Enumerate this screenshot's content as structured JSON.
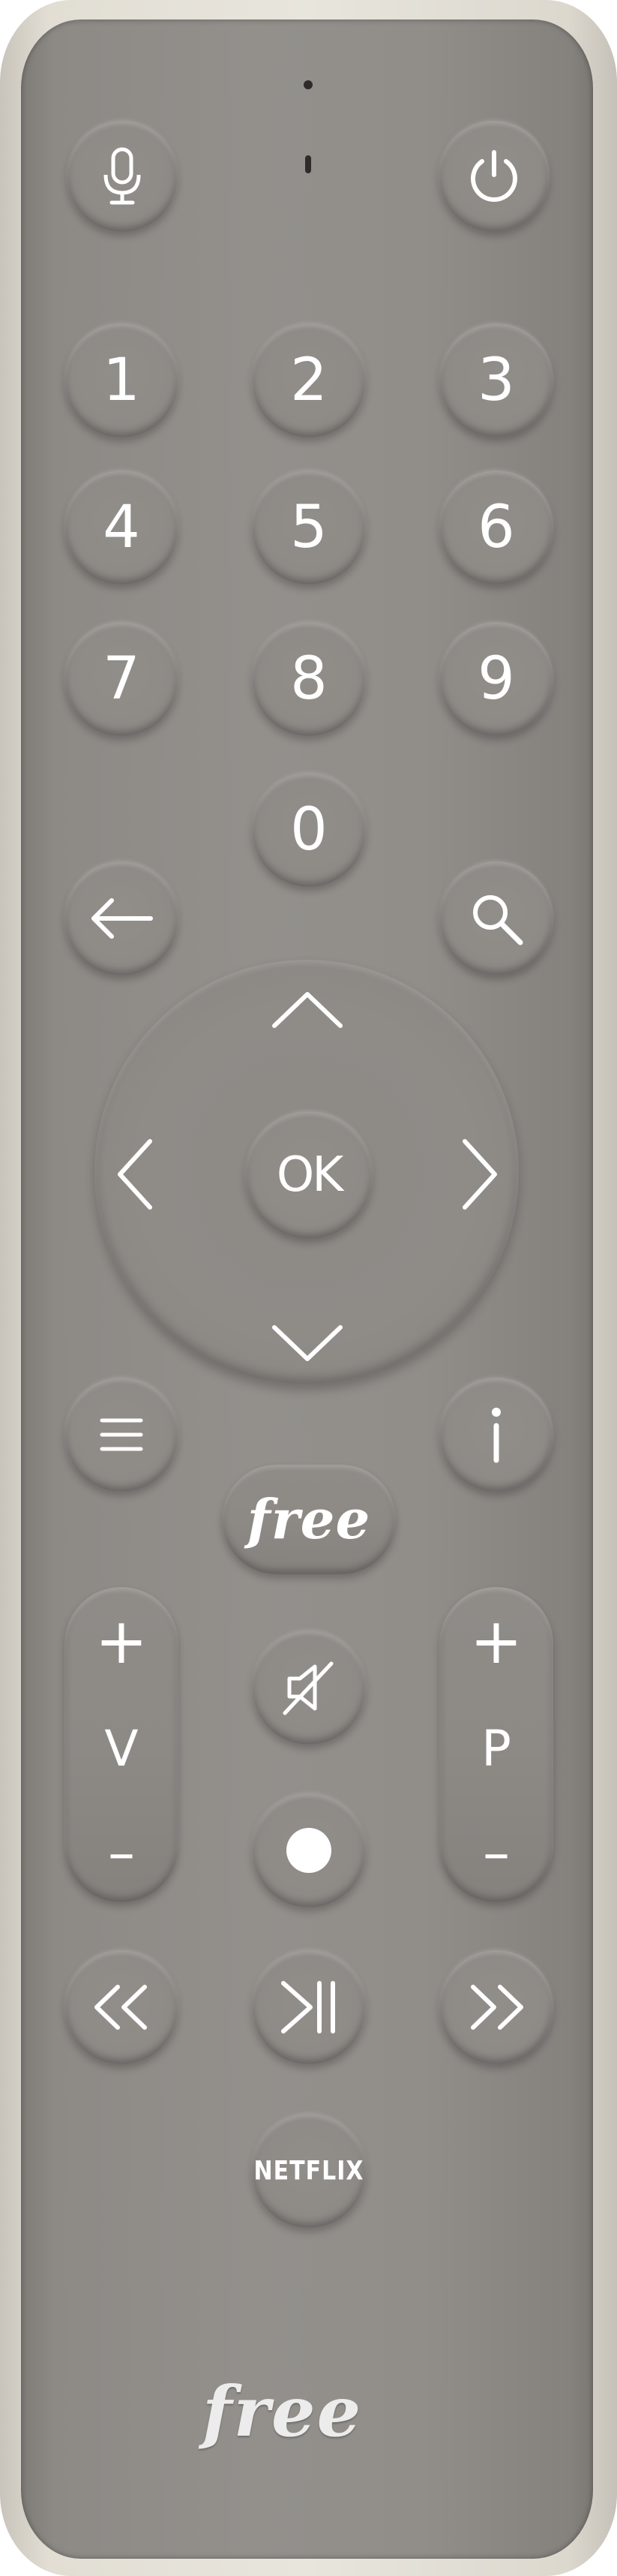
{
  "remote": {
    "digits": [
      "1",
      "2",
      "3",
      "4",
      "5",
      "6",
      "7",
      "8",
      "9",
      "0"
    ],
    "ok_label": "OK",
    "free_button_label": "free",
    "volume": {
      "plus": "+",
      "label": "V",
      "minus": "–"
    },
    "program": {
      "plus": "+",
      "label": "P",
      "minus": "–"
    },
    "netflix_label": "NETFLIX",
    "bottom_brand": "free",
    "icons": [
      "microphone-icon",
      "power-icon",
      "back-arrow-icon",
      "search-icon",
      "chevron-up-icon",
      "chevron-left-icon",
      "chevron-right-icon",
      "chevron-down-icon",
      "menu-icon",
      "info-icon",
      "mute-icon",
      "record-icon",
      "rewind-icon",
      "play-pause-icon",
      "fast-forward-icon"
    ],
    "colors": {
      "body": "#908d89",
      "shell": "#e3dfd6",
      "label": "#ffffff"
    }
  }
}
